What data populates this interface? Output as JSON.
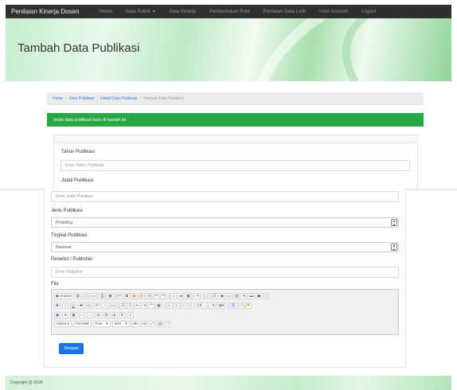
{
  "navbar": {
    "brand": "Penilaian Kinerja Dosen",
    "items": [
      {
        "label": "Home"
      },
      {
        "label": "Data Pokok",
        "caret": "▼"
      },
      {
        "label": "Data Kinerja"
      },
      {
        "label": "Pembentukan Role"
      },
      {
        "label": "Penilaian Data Lulih"
      },
      {
        "label": "User Account"
      },
      {
        "label": "Logout"
      }
    ]
  },
  "banner": {
    "title": "Tambah Data Publikasi"
  },
  "breadcrumb": {
    "items": [
      "Home",
      "Data Publikasi",
      "Detail Data Publikasi",
      "Tambah Data Publikasi"
    ],
    "separator": "/"
  },
  "alert": {
    "text": "Isilah data publikasi baru di bawah ini :"
  },
  "form": {
    "tahun": {
      "label": "Tahun Publikasi",
      "placeholder": "Enter Tahun Publikasi"
    },
    "judul": {
      "label": "Judul Publikasi",
      "placeholder": "Enter Judul Publikasi"
    },
    "jenis": {
      "label": "Jenis Publikasi",
      "value": "Prosiding"
    },
    "tingkat": {
      "label": "Tingkat Publikasi",
      "value": "Nasional"
    },
    "penerbit": {
      "label": "Penerbit / Publisher",
      "placeholder": "Enter Publisher"
    },
    "file": {
      "label": "File"
    },
    "submit_label": "Simpan"
  },
  "editor": {
    "source_label": "Source",
    "styles_label": "Styles",
    "format_label": "Format",
    "font_label": "Font",
    "size_label": "Size"
  },
  "footer": {
    "text": "Copyright @ 2018"
  }
}
